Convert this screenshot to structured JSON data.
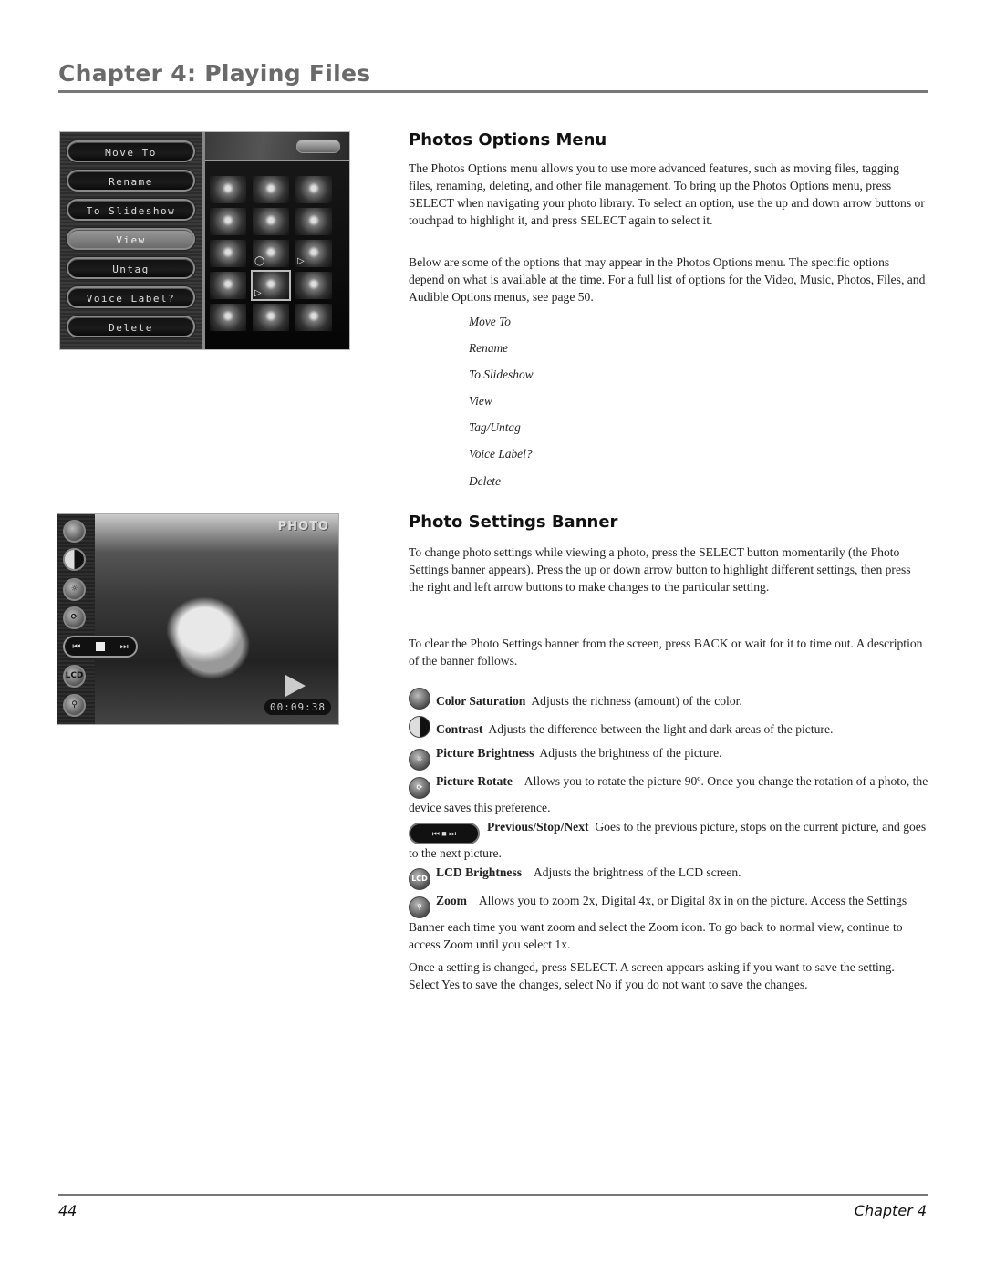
{
  "header": {
    "chapter_title": "Chapter 4: Playing Files"
  },
  "options_menu_screen": {
    "buttons": [
      "Move To",
      "Rename",
      "To Slideshow",
      "View",
      "Untag",
      "Voice Label?",
      "Delete"
    ],
    "selected": "View",
    "thumb_icons": {
      "voice": "speech-bubble",
      "play": "▷"
    }
  },
  "photo_settings_screen": {
    "label": "PHOTO",
    "timecode": "00:09:38",
    "buttons": [
      "color-saturation",
      "contrast",
      "picture-brightness",
      "picture-rotate",
      "previous-stop-next",
      "lcd-brightness",
      "zoom"
    ],
    "lcd_text": "LCD"
  },
  "sections": {
    "options_menu": {
      "heading": "Photos Options Menu",
      "para1": "The Photos Options menu allows you to use more advanced features, such as moving files, tagging files, renaming, deleting, and other file management. To bring up the Photos Options menu, press SELECT when navigating your photo library. To select an option, use the up and down arrow buttons or touchpad to highlight it, and press SELECT again to select it.",
      "para2": "Below are some of the options that may appear in the Photos Options menu.  The specific options depend on what is available at the time. For a full list of options for the Video, Music, Photos, Files, and Audible Options menus, see page 50.",
      "options": [
        "Move To",
        "Rename",
        "To Slideshow",
        "View",
        "Tag/Untag",
        "Voice Label?",
        "Delete"
      ]
    },
    "settings_banner": {
      "heading": "Photo Settings Banner",
      "para1": "To change photo settings while viewing a photo, press the SELECT button momentarily (the Photo Settings banner appears). Press the up or down arrow button to highlight different settings, then press the right and left arrow buttons to make changes to the particular setting.",
      "para2": "To clear the Photo Settings banner from the screen, press BACK or wait for it to time out. A description of the banner follows.",
      "settings": [
        {
          "name": "Color Saturation",
          "desc": "Adjusts the richness (amount) of the color."
        },
        {
          "name": "Contrast",
          "desc": "Adjusts the difference between the light and dark areas of the picture."
        },
        {
          "name": "Picture Brightness",
          "desc": "Adjusts the brightness of the picture."
        },
        {
          "name": "Picture Rotate",
          "desc": "Allows you to rotate the picture 90º. Once you change the rotation of a photo, the device saves this preference."
        },
        {
          "name": "Previous/Stop/Next",
          "desc": "Goes to the previous picture, stops on the current picture, and goes to the next picture."
        },
        {
          "name": "LCD Brightness",
          "desc": "Adjusts the brightness of the LCD screen."
        },
        {
          "name": "Zoom",
          "desc": "Allows you to zoom 2x, Digital 4x, or Digital 8x in on the picture. Access the Settings Banner each time you want zoom and select the Zoom icon. To go back to normal view, continue to access Zoom until you select 1x."
        }
      ],
      "closing": "Once a setting is changed, press SELECT. A screen appears asking if you want to save the setting. Select Yes to save the changes, select No if you do not want to save the changes."
    }
  },
  "footer": {
    "page_number": "44",
    "chapter_label": "Chapter  4"
  }
}
